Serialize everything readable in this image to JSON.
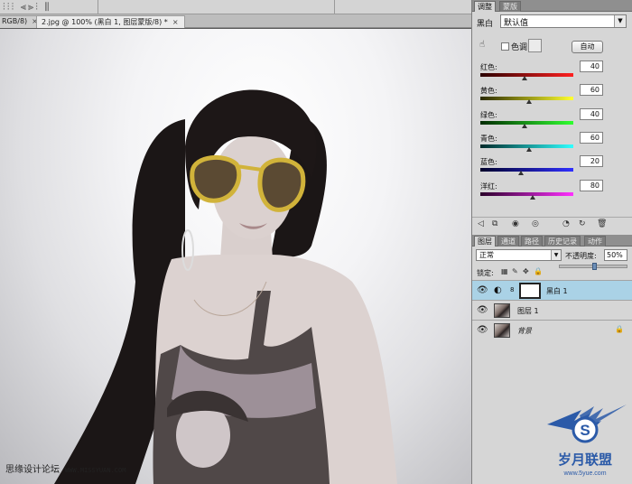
{
  "tabs": [
    {
      "label": "RGB/8)",
      "active": false
    },
    {
      "label": "2.jpg @ 100% (黑白 1, 图层蒙版/8) *",
      "active": true
    }
  ],
  "adjustments_panel": {
    "tabs": [
      "调整",
      "蒙版"
    ],
    "preset_label": "黑白",
    "preset_value": "默认值",
    "tint_label": "色调",
    "tint_checked": false,
    "auto_label": "自动",
    "sliders": [
      {
        "label": "红色:",
        "value": "40",
        "color_from": "#2a0000",
        "color_to": "#ff2020"
      },
      {
        "label": "黄色:",
        "value": "60",
        "color_from": "#2a2a00",
        "color_to": "#ffff30"
      },
      {
        "label": "绿色:",
        "value": "40",
        "color_from": "#002a00",
        "color_to": "#30ff30"
      },
      {
        "label": "青色:",
        "value": "60",
        "color_from": "#002a2a",
        "color_to": "#30ffff"
      },
      {
        "label": "蓝色:",
        "value": "20",
        "color_from": "#00002a",
        "color_to": "#3030ff"
      },
      {
        "label": "洋红:",
        "value": "80",
        "color_from": "#2a002a",
        "color_to": "#ff30ff"
      }
    ]
  },
  "layers_panel": {
    "tabs": [
      "图层",
      "通道",
      "路径",
      "历史记录",
      "动作"
    ],
    "blend_mode": "正常",
    "opacity_label": "不透明度:",
    "opacity_value": "50%",
    "opacity_fraction": 0.5,
    "lock_label": "锁定:",
    "layers": [
      {
        "name": "黑白 1",
        "type": "adjustment",
        "selected": true,
        "visible": true
      },
      {
        "name": "图层 1",
        "type": "image",
        "selected": false,
        "visible": true
      },
      {
        "name": "背景",
        "type": "background",
        "selected": false,
        "visible": true,
        "locked": true
      }
    ]
  },
  "watermarks": {
    "left_text": "思缘设计论坛",
    "left_url": "WWW.MISSYUAN.COM",
    "logo_text": "岁月联盟",
    "logo_url": "www.5yue.com",
    "logo_letter": "S"
  },
  "colors": {
    "selected_layer": "#aad2e6",
    "panel_bg": "#d6d6d6",
    "logo_blue": "#2b5aa8"
  }
}
